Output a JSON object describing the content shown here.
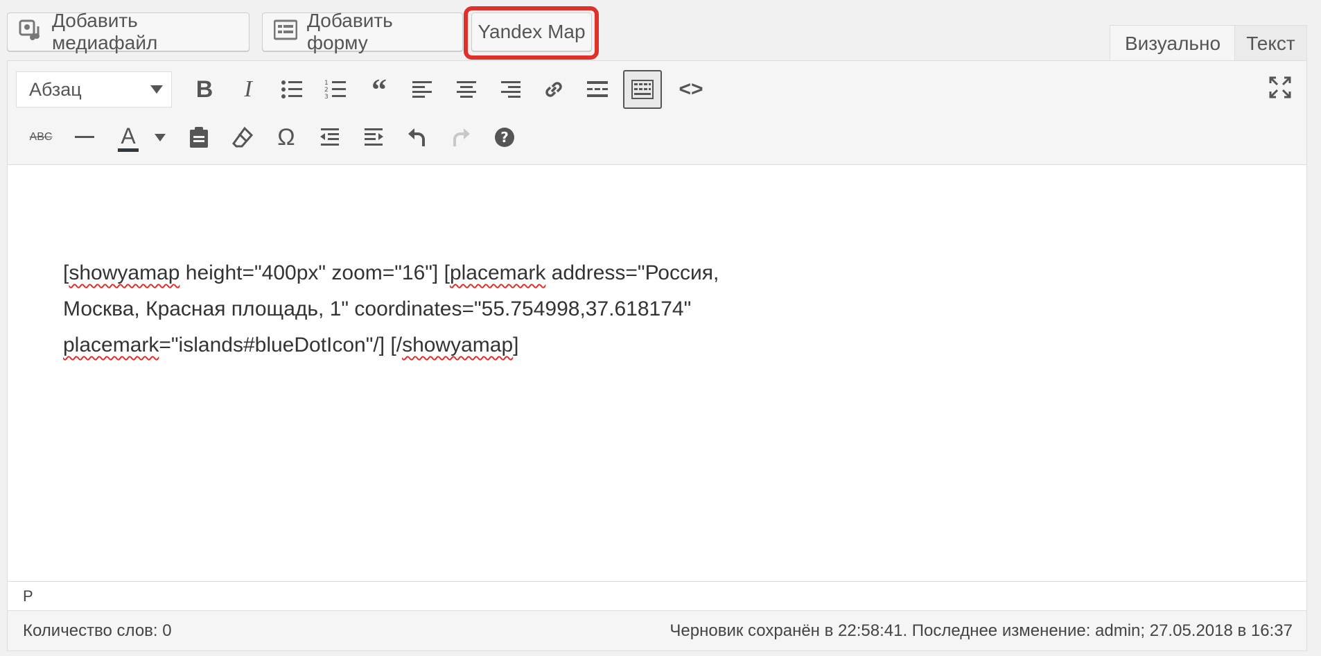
{
  "media_buttons": {
    "add_media": "Добавить медиафайл",
    "add_form": "Добавить форму",
    "yandex_map": "Yandex Map"
  },
  "tabs": {
    "visual": "Визуально",
    "text": "Текст"
  },
  "toolbar": {
    "format_select": "Абзац",
    "row1": [
      "bold-icon",
      "italic-icon",
      "bullet-list-icon",
      "numbered-list-icon",
      "blockquote-icon",
      "align-left-icon",
      "align-center-icon",
      "align-right-icon",
      "link-icon",
      "read-more-icon",
      "toolbar-toggle-icon",
      "code-icon"
    ],
    "row2": [
      "strikethrough-icon",
      "horizontal-line-icon",
      "text-color-icon",
      "paste-text-icon",
      "clear-formatting-icon",
      "special-char-icon",
      "outdent-icon",
      "indent-icon",
      "undo-icon",
      "redo-icon",
      "help-icon"
    ]
  },
  "content": {
    "parts": [
      "[",
      "showyamap",
      " height=\"400px\" zoom=\"16\"] [",
      "placemark",
      " address=\"Россия,",
      "Москва, Красная площадь, 1\" coordinates=\"55.754998,37.618174\"",
      "placemark",
      "=\"islands#blueDotIcon\"/] [/",
      "showyamap",
      "]"
    ]
  },
  "path": "P",
  "status": {
    "word_count": "Количество слов: 0",
    "saved": "Черновик сохранён в 22:58:41. Последнее изменение: admin; 27.05.2018 в 16:37"
  }
}
